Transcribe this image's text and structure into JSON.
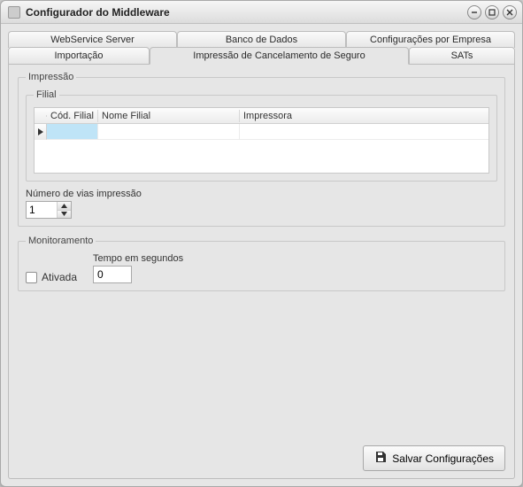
{
  "window": {
    "title": "Configurador do Middleware"
  },
  "tabs": {
    "row1": [
      {
        "label": "WebService Server"
      },
      {
        "label": "Banco de Dados"
      },
      {
        "label": "Configurações por Empresa"
      }
    ],
    "row2": [
      {
        "label": "Importação"
      },
      {
        "label": "Impressão de Cancelamento de Seguro",
        "active": true
      },
      {
        "label": "SATs"
      }
    ]
  },
  "impressao": {
    "legend": "Impressão",
    "filial": {
      "legend": "Filial",
      "columns": {
        "cod_filial": "Cód. Filial",
        "nome_filial": "Nome Filial",
        "impressora": "Impressora"
      },
      "rows": [
        {
          "cod_filial": "",
          "nome_filial": "",
          "impressora": ""
        }
      ]
    },
    "numero_vias": {
      "label": "Número de vias impressão",
      "value": "1"
    }
  },
  "monitoramento": {
    "legend": "Monitoramento",
    "ativada": {
      "label": "Ativada",
      "checked": false
    },
    "tempo": {
      "label": "Tempo em segundos",
      "value": "0"
    }
  },
  "footer": {
    "save_label": "Salvar Configurações"
  }
}
